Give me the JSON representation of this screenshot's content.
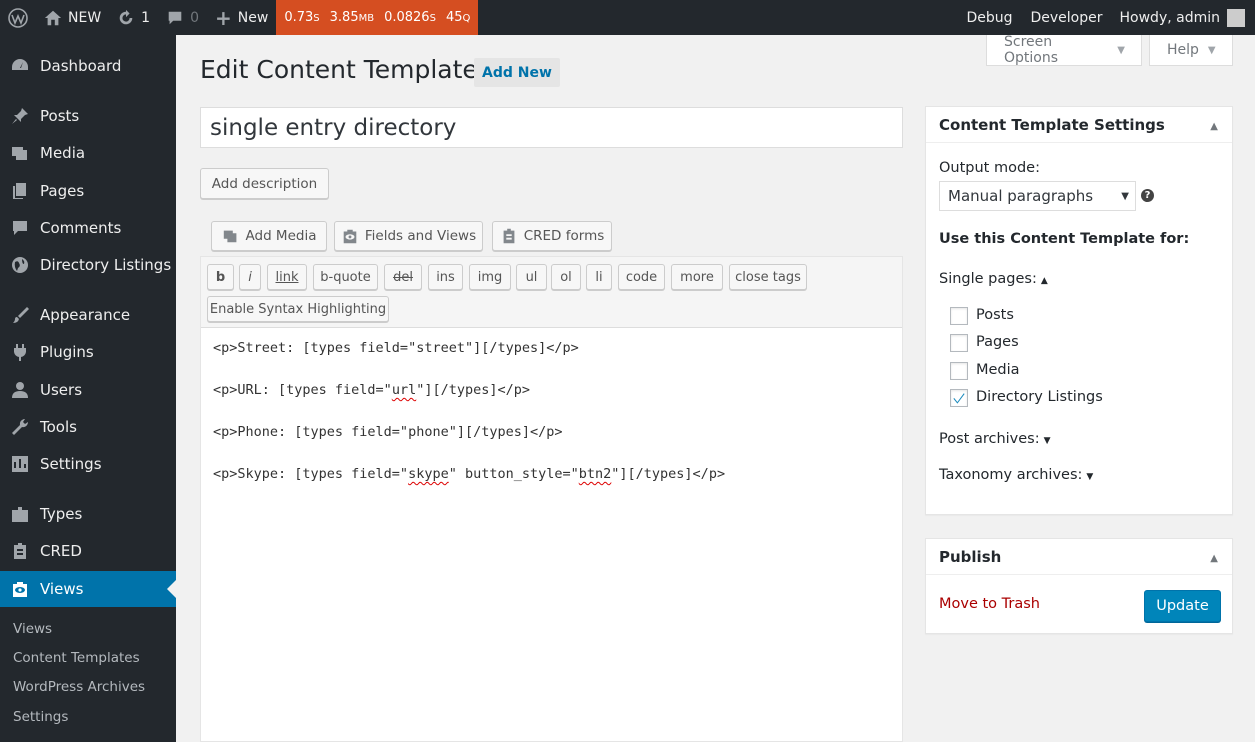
{
  "adminbar": {
    "site_name": "NEW",
    "updates_count": "1",
    "comments_count": "0",
    "new_label": "New",
    "perf": {
      "time": "0.73",
      "time_unit": "S",
      "memory": "3.85",
      "memory_unit": "MB",
      "query_time": "0.0826",
      "query_time_unit": "S",
      "queries": "45",
      "queries_unit": "Q"
    },
    "debug_label": "Debug",
    "developer_label": "Developer",
    "howdy_label": "Howdy, admin"
  },
  "sidebar": {
    "items": [
      {
        "label": "Dashboard",
        "icon": "dashboard-icon"
      },
      {
        "label": "Posts",
        "icon": "pin-icon"
      },
      {
        "label": "Media",
        "icon": "media-icon"
      },
      {
        "label": "Pages",
        "icon": "pages-icon"
      },
      {
        "label": "Comments",
        "icon": "comment-icon"
      },
      {
        "label": "Directory Listings",
        "icon": "globe-icon"
      },
      {
        "label": "Appearance",
        "icon": "brush-icon"
      },
      {
        "label": "Plugins",
        "icon": "plug-icon"
      },
      {
        "label": "Users",
        "icon": "user-icon"
      },
      {
        "label": "Tools",
        "icon": "wrench-icon"
      },
      {
        "label": "Settings",
        "icon": "settings-icon"
      },
      {
        "label": "Types",
        "icon": "types-icon"
      },
      {
        "label": "CRED",
        "icon": "cred-icon"
      },
      {
        "label": "Views",
        "icon": "views-icon"
      }
    ],
    "submenu": [
      "Views",
      "Content Templates",
      "WordPress Archives",
      "Settings"
    ]
  },
  "screen_options_label": "Screen Options",
  "help_label": "Help",
  "page_title": "Edit Content Template",
  "add_new_label": "Add New",
  "template_title": "single entry directory",
  "add_description_label": "Add description",
  "media_buttons": {
    "add_media": "Add Media",
    "fields_and_views": "Fields and Views",
    "cred_forms": "CRED forms"
  },
  "quicktags": [
    "b",
    "i",
    "link",
    "b-quote",
    "del",
    "ins",
    "img",
    "ul",
    "ol",
    "li",
    "code",
    "more",
    "close tags"
  ],
  "syntax_highlighting_label": "Enable Syntax Highlighting",
  "code_lines": {
    "l1": "<p>Street: [types field=\"street\"][/types]</p>",
    "l2_a": "<p>URL: [types field=\"",
    "l2_b": "url",
    "l2_c": "\"][/types]</p>",
    "l3": "<p>Phone: [types field=\"phone\"][/types]</p>",
    "l4_a": "<p>Skype: [types field=\"",
    "l4_b": "skype",
    "l4_c": "\" button_style=\"",
    "l4_d": "btn2",
    "l4_e": "\"][/types]</p>"
  },
  "settings_box": {
    "title": "Content Template Settings",
    "output_mode_label": "Output mode:",
    "output_mode_value": "Manual paragraphs",
    "use_for_label": "Use this Content Template for:",
    "single_pages_label": "Single pages:",
    "single_pages": [
      {
        "label": "Posts",
        "checked": false
      },
      {
        "label": "Pages",
        "checked": false
      },
      {
        "label": "Media",
        "checked": false
      },
      {
        "label": "Directory Listings",
        "checked": true
      }
    ],
    "post_archives_label": "Post archives:",
    "taxonomy_archives_label": "Taxonomy archives:"
  },
  "publish_box": {
    "title": "Publish",
    "trash_label": "Move to Trash",
    "update_label": "Update"
  },
  "colors": {
    "adminbar_bg": "#23282d",
    "perf_bg": "#d54e21",
    "accent": "#0073aa",
    "primary_button": "#0085ba",
    "trash": "#a00"
  }
}
